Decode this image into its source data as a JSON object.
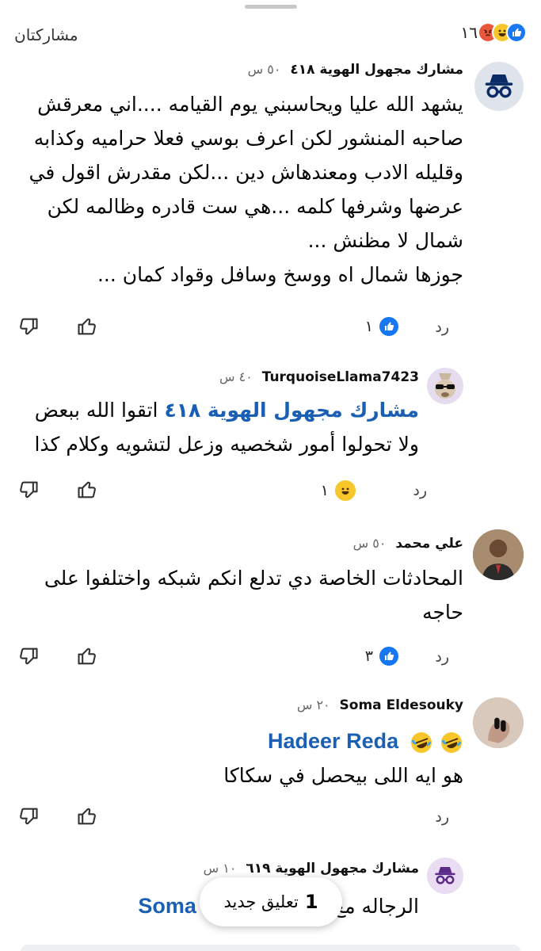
{
  "header": {
    "shares_label": "مشاركتان",
    "reaction_count": "١٦",
    "reactions": [
      "like",
      "haha",
      "angry"
    ]
  },
  "comments": [
    {
      "author": "مشارك مجهول الهوية ٤١٨",
      "time": "٥٠ س",
      "text": "يشهد الله عليا ويحاسبني يوم القيامه ....اني معرقش صاحبه المنشور لكن اعرف بوسي فعلا حراميه وكذابه وقليله الادب ومعندهاش دين ...لكن مقدرش اقول في عرضها وشرفها كلمه ...هي ست قادره وظالمه لكن شمال لا مظنش ...\nجوزها شمال اه ووسخ وسافل وقواد كمان ...",
      "reply_label": "رد",
      "reaction_count": "١",
      "reaction": "like"
    },
    {
      "author": "TurquoiseLlama7423",
      "time": "٤٠ س",
      "mention": "مشارك مجهول الهوية ٤١٨",
      "text": "اتقوا الله ببعض ولا تحولوا أمور شخصيه وزعل لتشويه وكلام كذا",
      "reply_label": "رد",
      "reaction_count": "١",
      "reaction": "haha"
    },
    {
      "author": "علي محمد",
      "time": "٥٠ س",
      "text": "المحادثات الخاصة دي تدلع انكم شبكه واختلفوا على حاجه",
      "reply_label": "رد",
      "reaction_count": "٣",
      "reaction": "like"
    },
    {
      "author": "Soma Eldesouky",
      "time": "٢٠ س",
      "mention": "Hadeer Reda",
      "text": "هو ايه اللى بيحصل في سكاكا",
      "reply_label": "رد"
    },
    {
      "author": "مشارك مجهول الهوية ٦١٩",
      "time": "١٠ س",
      "mention": "Soma Eldeso",
      "text": "الرجاله مع"
    }
  ],
  "toast": {
    "count": "1",
    "label": "تعليق جديد"
  },
  "colors": {
    "link": "#1b5fb5",
    "like": "#1877f2",
    "haha": "#f7c62a",
    "angry": "#e9573a"
  }
}
